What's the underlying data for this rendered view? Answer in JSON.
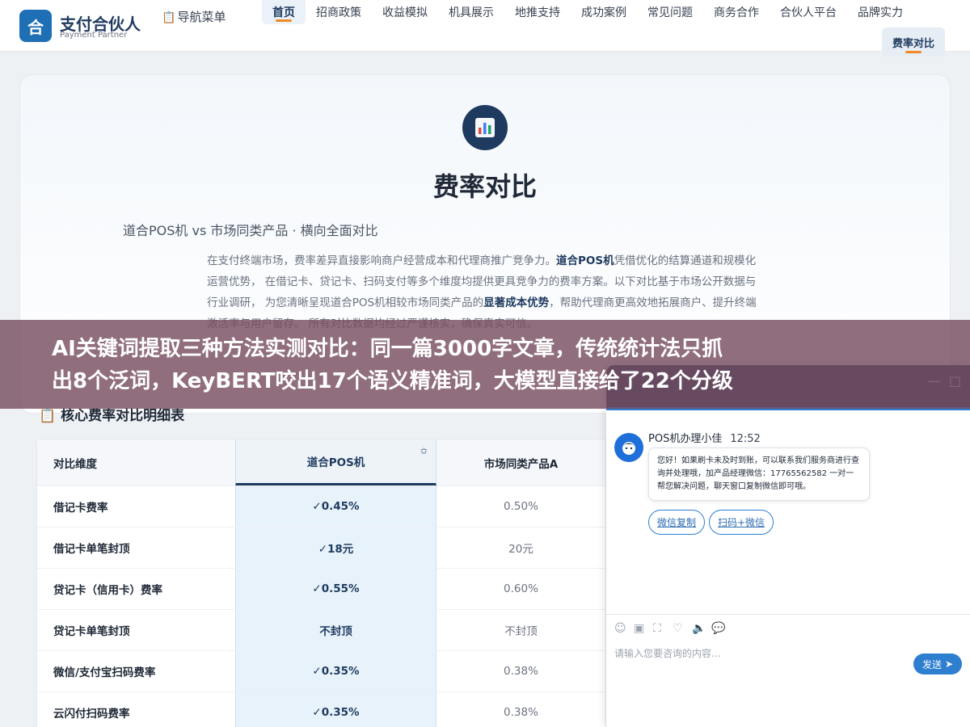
{
  "header": {
    "logo_char": "合",
    "brand_title": "支付合伙人",
    "brand_subtitle": "Payment Partner",
    "nav_menu_label": "导航菜单",
    "nav_items": [
      "首页",
      "招商政策",
      "收益模拟",
      "机具展示",
      "地推支持",
      "成功案例",
      "常见问题",
      "商务合作",
      "合伙人平台",
      "品牌实力"
    ],
    "nav_active": "首页",
    "nav_second_row": "费率对比"
  },
  "hero": {
    "title": "费率对比",
    "subtitle": "道合POS机 vs 市场同类产品 · 横向全面对比",
    "desc_1": "在支付终端市场，费率差异直接影响商户经营成本和代理商推广竞争力。",
    "desc_bold_1": "道合POS机",
    "desc_2": "凭借优化的结算通道和规模化运营优势， 在借记卡、贷记卡、扫码支付等多个维度均提供更具竞争力的费率方案。以下对比基于市场公开数据与行业调研， 为您清晰呈现道合POS机相较市场同类产品的",
    "desc_bold_2": "显著成本优势",
    "desc_3": "，帮助代理商更高效地拓展商户、提升终端激活率与用户留存。 所有对比数据均经过严谨核实，确保真实可信。"
  },
  "banner": {
    "line1": "AI关键词提取三种方法实测对比：同一篇3000字文章，传统统计法只抓",
    "line2": "出8个泛词，KeyBERT咬出17个语义精准词，大模型直接给了22个分级"
  },
  "table": {
    "heading": "核心费率对比明细表",
    "columns": [
      "对比维度",
      "道合POS机",
      "市场同类产品A"
    ],
    "rows": [
      [
        "借记卡费率",
        "✓0.45%",
        "0.50%"
      ],
      [
        "借记卡单笔封顶",
        "✓18元",
        "20元"
      ],
      [
        "贷记卡（信用卡）费率",
        "✓0.55%",
        "0.60%"
      ],
      [
        "贷记卡单笔封顶",
        "不封顶",
        "不封顶"
      ],
      [
        "微信/支付宝扫码费率",
        "✓0.35%",
        "0.38%"
      ],
      [
        "云闪付扫码费率",
        "✓0.35%",
        "0.38%"
      ]
    ]
  },
  "chat": {
    "agent_name": "POS机办理小佳",
    "time": "12:52",
    "message": "您好！如果刷卡未及时到账，可以联系我们服务商进行查询并处理哦，加产品经理微信：17765562582 一对一帮您解决问题，聊天窗口复制微信即可哦。",
    "chips": [
      "微信复制",
      "扫码+微信"
    ],
    "input_placeholder": "请输入您要咨询的内容...",
    "send_label": "发送",
    "minimize_symbol": "—",
    "close_symbol": "□",
    "accent_color": "#2f7fd1"
  }
}
